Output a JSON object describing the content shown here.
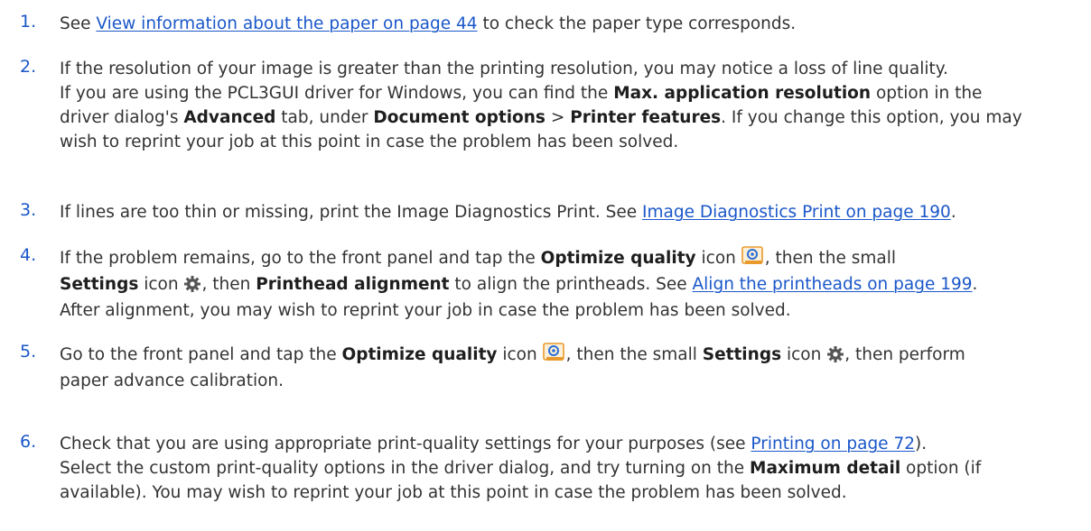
{
  "steps": [
    {
      "num": "1.",
      "l1": {
        "link": "View information about the paper on page 44",
        "pre": "See ",
        "post": " to check the paper type corresponds."
      }
    },
    {
      "num": "2.",
      "l1": "If the resolution of your image is greater than the printing resolution, you may notice a loss of line quality.",
      "l2": {
        "a": "If you are using the PCL3GUI driver for Windows, you can find the ",
        "b": "Max. application resolution",
        "c": " option in the"
      },
      "l3": {
        "a": "driver dialog's ",
        "b": "Advanced",
        "c": " tab, under ",
        "d": "Document options",
        "e": " > ",
        "f": "Printer features",
        "g": ". If you change this option, you may"
      },
      "l4": "wish to reprint your job at this point in case the problem has been solved."
    },
    {
      "num": "3.",
      "l1": {
        "pre": "If lines are too thin or missing, print the Image Diagnostics Print. See ",
        "link": "Image Diagnostics Print on page 190",
        "post": "."
      }
    },
    {
      "num": "4.",
      "l1": {
        "a": "If the problem remains, go to the front panel and tap the ",
        "b": "Optimize quality",
        "c": "  icon ",
        "d": ", then the small"
      },
      "l2": {
        "a": "Settings",
        "b": "  icon ",
        "c": ", then ",
        "d": "Printhead alignment",
        "e": " to align the printheads. See ",
        "link": "Align the printheads on page 199",
        "f": "."
      },
      "l3": "After alignment, you may wish to reprint your job in case the problem has been solved."
    },
    {
      "num": "5.",
      "l1": {
        "a": "Go to the front panel and tap the ",
        "b": "Optimize quality",
        "c": "  icon ",
        "d": ", then the small ",
        "e": "Settings",
        "f": "  icon ",
        "g": ", then perform"
      },
      "l2": "paper advance calibration."
    },
    {
      "num": "6.",
      "l1": {
        "pre": "Check that you are using appropriate print-quality settings for your purposes (see ",
        "link": "Printing on page 72",
        "post": ")."
      },
      "l2": {
        "a": "Select the custom print-quality options in the driver dialog, and try turning on the ",
        "b": "Maximum detail",
        "c": " option (if"
      },
      "l3": "available). You may wish to reprint your job at this point in case the problem has been solved."
    }
  ],
  "icons": {
    "optimize": "optimize-quality-icon",
    "settings": "settings-gear-icon"
  },
  "colors": {
    "accent": "#1a57c9",
    "text": "#333333",
    "icon_orange": "#e89a2c",
    "icon_blue": "#2b6fd6",
    "gear": "#555555"
  }
}
